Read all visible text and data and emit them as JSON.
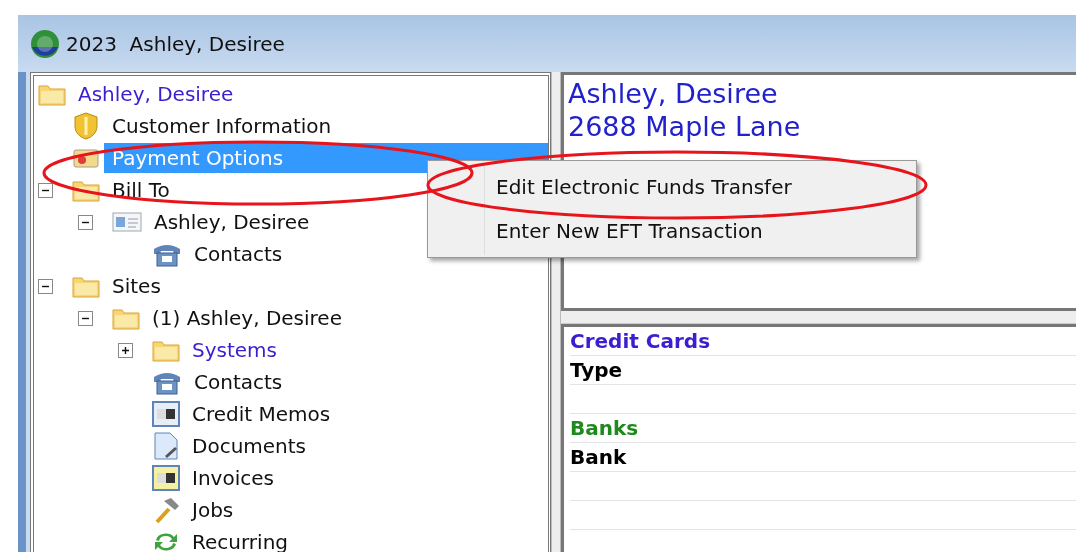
{
  "window": {
    "title": "2023  Ashley, Desiree"
  },
  "tree": [
    {
      "label": "Ashley, Desiree",
      "kind": "folder",
      "color": "#3a1fd0",
      "selected": false,
      "children": [
        {
          "label": "Customer Information",
          "kind": "shield",
          "selected": false
        },
        {
          "label": "Payment Options",
          "kind": "card",
          "selected": true
        },
        {
          "label": "Bill To",
          "kind": "folder",
          "selected": false,
          "expanded": true,
          "children": [
            {
              "label": "Ashley, Desiree",
              "kind": "idcard",
              "selected": false,
              "expanded": true,
              "children": [
                {
                  "label": "Contacts",
                  "kind": "phone",
                  "selected": false
                }
              ]
            }
          ]
        },
        {
          "label": "Sites",
          "kind": "folder",
          "selected": false,
          "expanded": true,
          "children": [
            {
              "label": "(1) Ashley, Desiree",
              "kind": "folder",
              "selected": false,
              "expanded": true,
              "children": [
                {
                  "label": "Systems",
                  "kind": "folder",
                  "color": "#3a1fd0",
                  "selected": false,
                  "expanded": false
                },
                {
                  "label": "Contacts",
                  "kind": "phone",
                  "selected": false
                },
                {
                  "label": "Credit Memos",
                  "kind": "memo",
                  "selected": false
                },
                {
                  "label": "Documents",
                  "kind": "document",
                  "selected": false
                },
                {
                  "label": "Invoices",
                  "kind": "invoice",
                  "selected": false
                },
                {
                  "label": "Jobs",
                  "kind": "hammer",
                  "selected": false
                },
                {
                  "label": "Recurring",
                  "kind": "recurring",
                  "selected": false
                }
              ]
            }
          ]
        }
      ]
    }
  ],
  "context_menu": {
    "items": [
      {
        "label": "Edit Electronic Funds Transfer"
      },
      {
        "label": "Enter New EFT Transaction"
      }
    ]
  },
  "summary": {
    "lines": [
      "Ashley, Desiree",
      "2688 Maple Lane"
    ]
  },
  "details": {
    "rows": [
      {
        "kind": "section",
        "label": "Credit Cards",
        "color": "#3a1fd0"
      },
      {
        "kind": "field",
        "label": "Type"
      },
      {
        "kind": "blank"
      },
      {
        "kind": "section",
        "label": "Banks",
        "color": "#1e8a1e"
      },
      {
        "kind": "field",
        "label": "Bank"
      },
      {
        "kind": "blank"
      },
      {
        "kind": "blank"
      },
      {
        "kind": "blank"
      }
    ]
  },
  "annotations": [
    {
      "kind": "ellipse"
    },
    {
      "kind": "ellipse"
    }
  ]
}
